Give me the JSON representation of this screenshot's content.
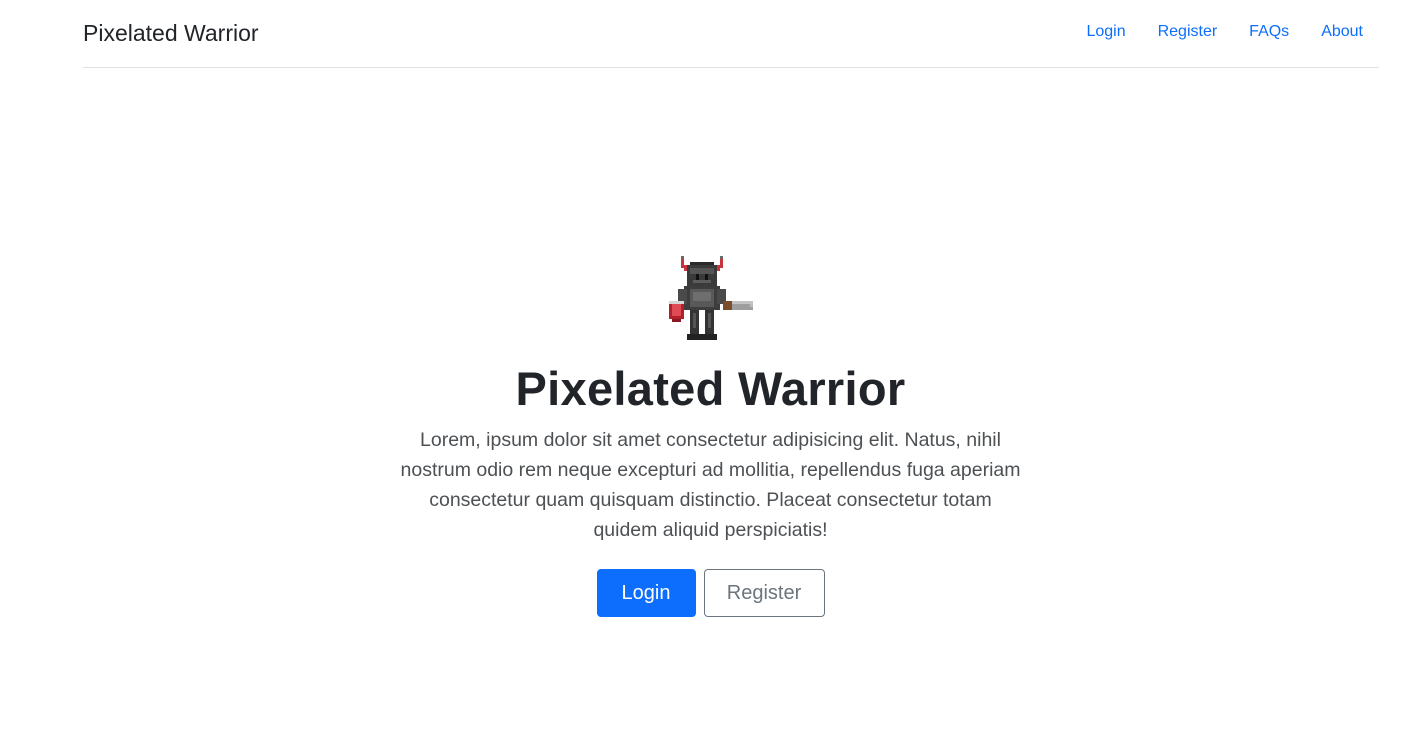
{
  "navbar": {
    "brand": "Pixelated Warrior",
    "links": [
      {
        "label": "Login"
      },
      {
        "label": "Register"
      },
      {
        "label": "FAQs"
      },
      {
        "label": "About"
      }
    ]
  },
  "hero": {
    "logo_icon": "pixel-warrior-icon",
    "title": "Pixelated Warrior",
    "lead": "Lorem, ipsum dolor sit amet consectetur adipisicing elit. Natus, nihil nostrum odio rem neque excepturi ad mollitia, repellendus fuga aperiam consectetur quam quisquam distinctio. Placeat consectetur totam quidem aliquid perspiciatis!",
    "primary_button": "Login",
    "secondary_button": "Register"
  },
  "colors": {
    "link": "#0d6efd",
    "primary": "#0d6efd",
    "secondary": "#6c757d",
    "text": "#212529"
  }
}
